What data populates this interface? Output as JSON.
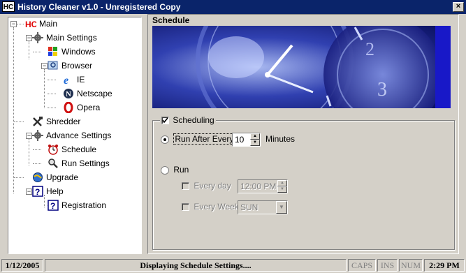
{
  "window": {
    "app_icon": "HC",
    "title": "History Cleaner v1.0 - Unregistered Copy",
    "close": "×"
  },
  "tree": {
    "main": {
      "label": "Main",
      "icon": "hc-logo-icon"
    },
    "main_settings": {
      "label": "Main Settings",
      "icon": "gear-icon"
    },
    "windows": {
      "label": "Windows",
      "icon": "windows-flag-icon"
    },
    "browser": {
      "label": "Browser",
      "icon": "globe-search-icon"
    },
    "ie": {
      "label": "IE",
      "icon": "ie-icon"
    },
    "netscape": {
      "label": "Netscape",
      "icon": "netscape-icon"
    },
    "opera": {
      "label": "Opera",
      "icon": "opera-icon"
    },
    "shredder": {
      "label": "Shredder",
      "icon": "tools-icon"
    },
    "advance_settings": {
      "label": "Advance Settings",
      "icon": "gear-icon"
    },
    "schedule": {
      "label": "Schedule",
      "icon": "alarm-clock-icon"
    },
    "run_settings": {
      "label": "Run Settings",
      "icon": "search-person-icon"
    },
    "upgrade": {
      "label": "Upgrade",
      "icon": "globe-upgrade-icon"
    },
    "help": {
      "label": "Help",
      "icon": "help-icon"
    },
    "registration": {
      "label": "Registration",
      "icon": "help-icon"
    }
  },
  "schedule_panel": {
    "title": "Schedule",
    "banner_numbers": [
      "2",
      "3"
    ],
    "scheduling_label": "Scheduling",
    "scheduling_checked": true,
    "run_after_every_label": "Run After Every",
    "run_after_every_value": "10",
    "minutes_label": "Minutes",
    "run_label": "Run",
    "every_day_label": "Every day",
    "every_day_time": "12:00 PM",
    "every_week_label": "Every Week",
    "every_week_day": "SUN"
  },
  "statusbar": {
    "date": "1/12/2005",
    "message": "Displaying Schedule Settings....",
    "caps": "CAPS",
    "ins": "INS",
    "num": "NUM",
    "time": "2:29 PM"
  }
}
